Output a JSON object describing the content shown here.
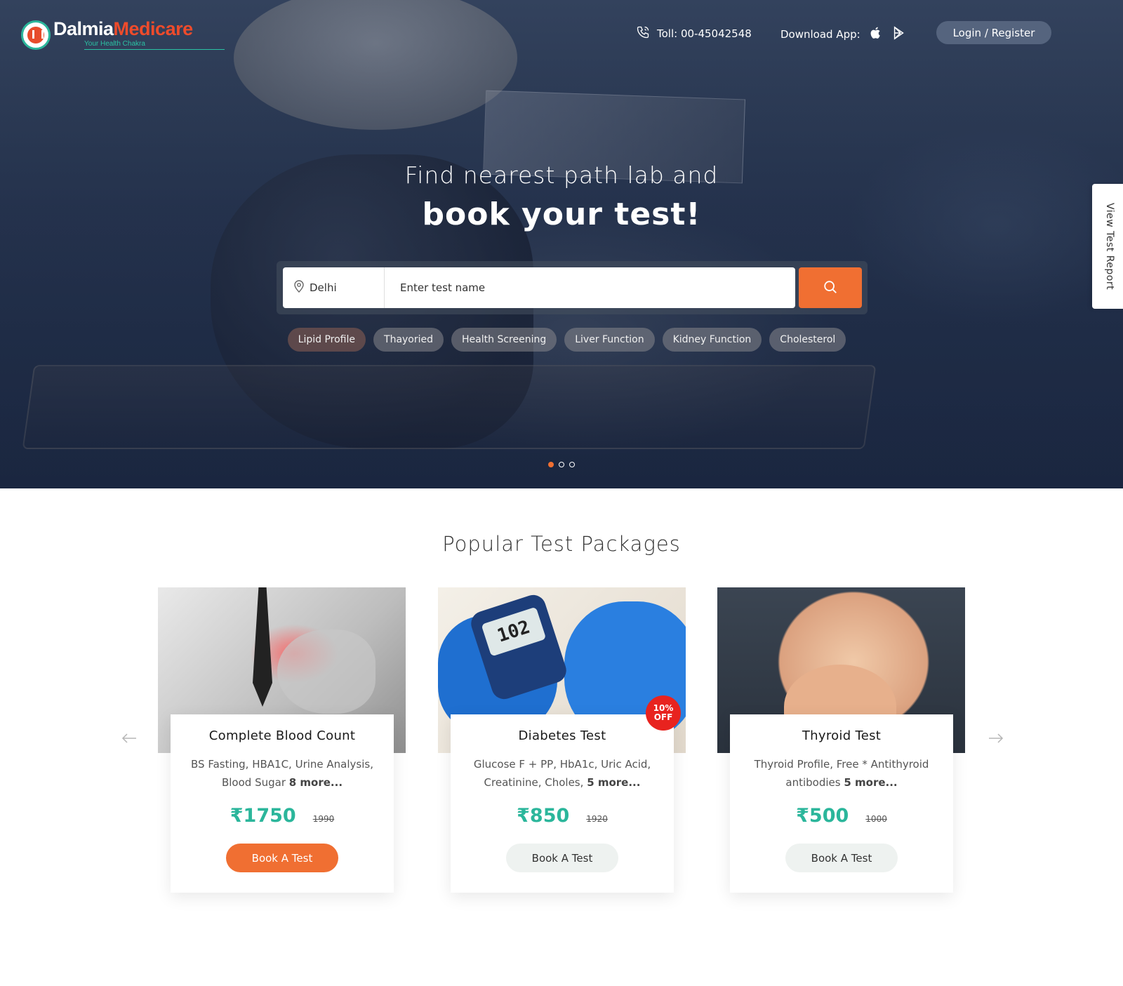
{
  "brand": {
    "name_part1": "Dalmia",
    "name_part2": "Medicare",
    "tagline": "Your Health Chakra"
  },
  "header": {
    "toll_label": "Toll: 00-45042548",
    "download_label": "Download App:",
    "login_label": "Login / Register"
  },
  "hero": {
    "subtitle": "Find nearest path lab and",
    "title": "book your test!",
    "location": "Delhi",
    "test_placeholder": "Enter test name",
    "chips": [
      "Lipid Profile",
      "Thayoried",
      "Health Screening",
      "Liver Function",
      "Kidney Function",
      "Cholesterol"
    ],
    "slides_total": 3,
    "active_slide": 1
  },
  "side_tab": {
    "label": "View Test Report"
  },
  "packages": {
    "title": "Popular Test Packages",
    "items": [
      {
        "title": "Complete Blood Count",
        "desc": "BS Fasting, HBA1C, Urine Analysis, Blood Sugar",
        "more": "8 more...",
        "price": "₹1750",
        "old_price": "1990",
        "cta": "Book A Test"
      },
      {
        "title": "Diabetes Test",
        "desc": "Glucose F + PP, HbA1c, Uric Acid, Creatinine, Choles,",
        "more": "5 more...",
        "price": "₹850",
        "old_price": "1920",
        "cta": "Book A Test",
        "badge_pct": "10%",
        "badge_off": "OFF",
        "meter_reading": "102"
      },
      {
        "title": "Thyroid Test",
        "desc": "Thyroid Profile, Free * Antithyroid antibodies",
        "more": "5 more...",
        "price": "₹500",
        "old_price": "1000",
        "cta": "Book A Test"
      }
    ]
  },
  "colors": {
    "accent": "#f06f32",
    "price": "#2bb69b",
    "badge": "#e8231f",
    "brand_red": "#ee4b2b"
  }
}
